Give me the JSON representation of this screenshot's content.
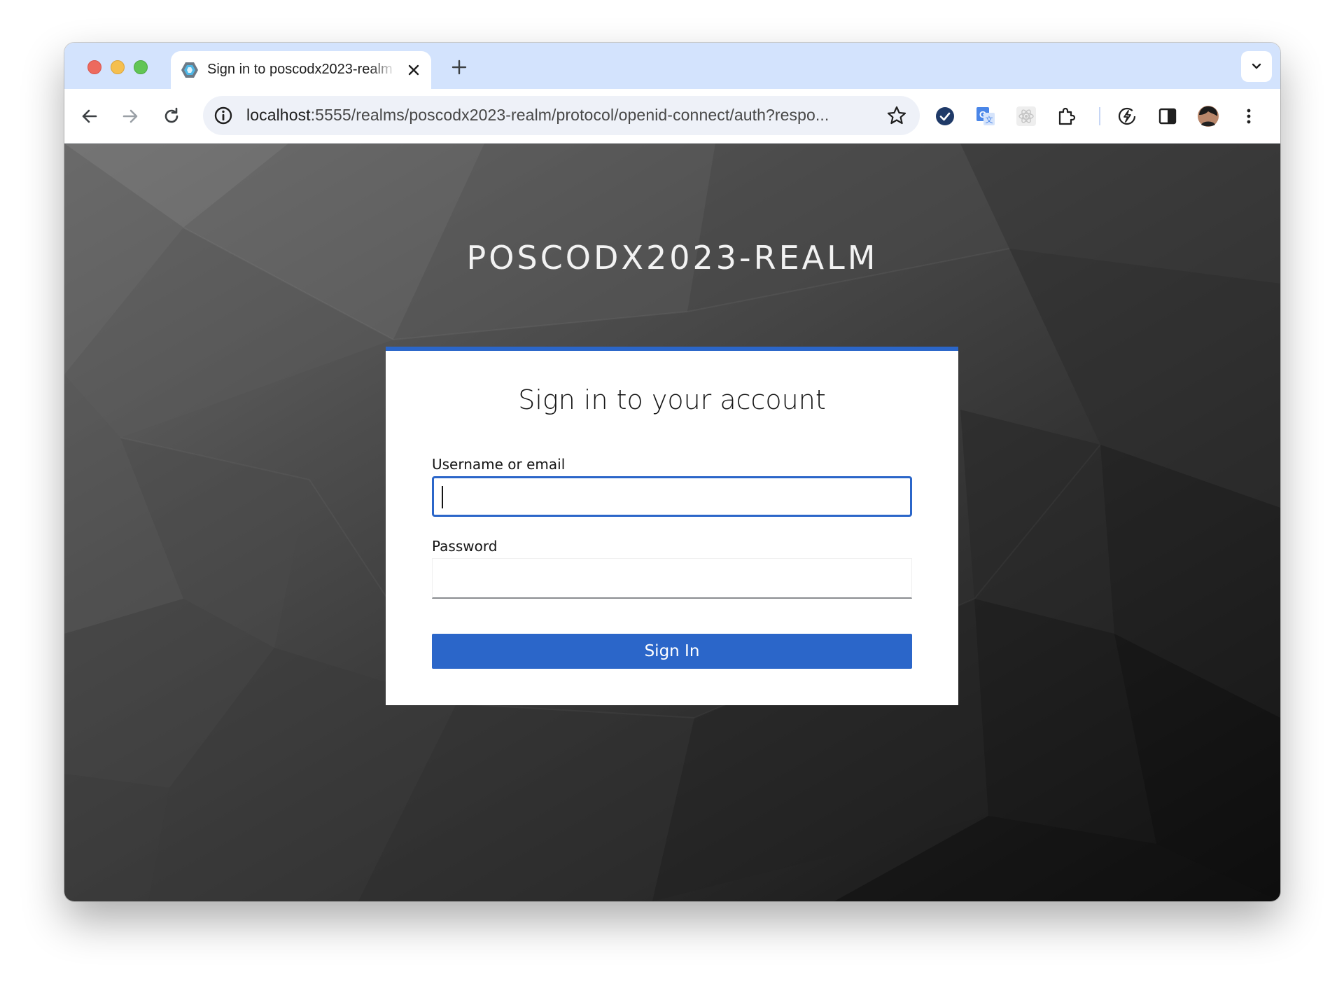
{
  "browser": {
    "tab": {
      "title": "Sign in to poscodx2023-realm",
      "favicon": "keycloak-icon"
    },
    "address_bar": {
      "host": "localhost",
      "rest": ":5555/realms/poscodx2023-realm/protocol/openid-connect/auth?respo..."
    },
    "toolbar_icons": [
      "back-icon",
      "forward-icon",
      "reload-icon",
      "site-info-icon",
      "bookmark-star-icon",
      "extension-check-icon",
      "translate-icon",
      "react-devtools-icon",
      "extensions-puzzle-icon",
      "performance-icon",
      "side-panel-icon",
      "profile-avatar",
      "more-menu-icon"
    ]
  },
  "page": {
    "realm_title": "POSCODX2023-REALM",
    "heading": "Sign in to your account",
    "username_label": "Username or email",
    "username_value": "",
    "password_label": "Password",
    "password_value": "",
    "submit_label": "Sign In"
  },
  "colors": {
    "accent": "#2b66c9",
    "tabstrip": "#d3e3fd",
    "card": "#ffffff"
  }
}
